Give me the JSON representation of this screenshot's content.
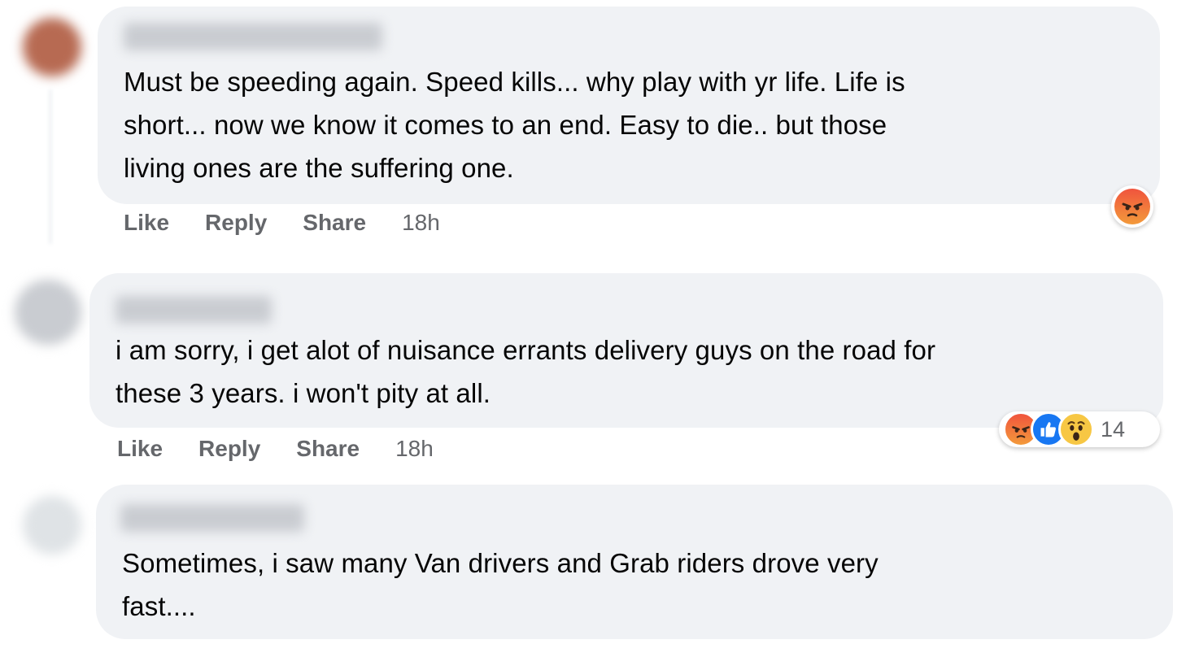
{
  "comments": [
    {
      "text_lines": [
        "Must be speeding again. Speed kills... why play with yr life. Life is",
        "short... now we know it comes to an end. Easy to die.. but those",
        "living ones are the suffering one."
      ],
      "actions": {
        "like": "Like",
        "reply": "Reply",
        "share": "Share"
      },
      "time": "18h",
      "reactions": {
        "icons": [
          "angry-icon"
        ],
        "count": ""
      }
    },
    {
      "text_lines": [
        "i am sorry, i get alot of nuisance errants delivery guys on the road for",
        "these 3 years. i won't pity at all."
      ],
      "actions": {
        "like": "Like",
        "reply": "Reply",
        "share": "Share"
      },
      "time": "18h",
      "reactions": {
        "icons": [
          "angry-icon",
          "like-icon",
          "wow-icon"
        ],
        "count": "14"
      }
    },
    {
      "text_lines": [
        "Sometimes, i saw many Van drivers and Grab riders drove very",
        "fast...."
      ]
    }
  ],
  "colors": {
    "bubble": "#f0f2f5",
    "action_text": "#65676b",
    "angry": "#f0543d",
    "like": "#1877f2",
    "wow": "#f7c744"
  }
}
